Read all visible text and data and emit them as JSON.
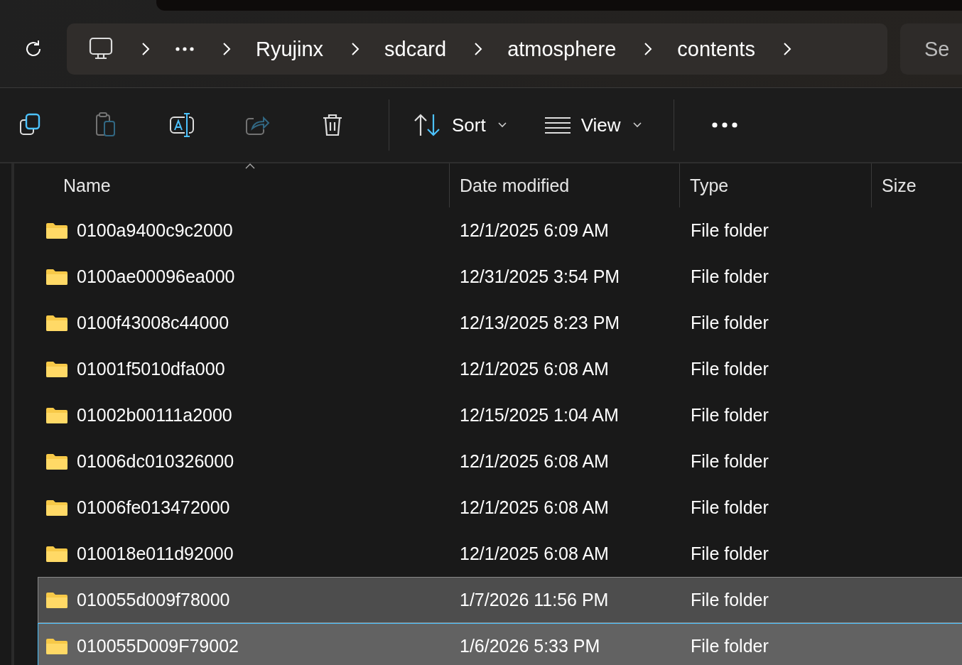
{
  "address_bar": {
    "crumbs": [
      "Ryujinx",
      "sdcard",
      "atmosphere",
      "contents"
    ],
    "search_placeholder": "Se"
  },
  "toolbar": {
    "buttons": [
      {
        "kind": "copy",
        "disabled": false
      },
      {
        "kind": "paste",
        "disabled": true
      },
      {
        "kind": "rename",
        "disabled": false
      },
      {
        "kind": "share",
        "disabled": true
      },
      {
        "kind": "delete",
        "disabled": false
      }
    ],
    "sort_label": "Sort",
    "view_label": "View"
  },
  "table": {
    "columns": [
      "Name",
      "Date modified",
      "Type",
      "Size"
    ],
    "rows": [
      {
        "name": "0100a9400c9c2000",
        "date": "12/1/2025 6:09 AM",
        "type": "File folder",
        "selected": false,
        "focused": false
      },
      {
        "name": "0100ae00096ea000",
        "date": "12/31/2025 3:54 PM",
        "type": "File folder",
        "selected": false,
        "focused": false
      },
      {
        "name": "0100f43008c44000",
        "date": "12/13/2025 8:23 PM",
        "type": "File folder",
        "selected": false,
        "focused": false
      },
      {
        "name": "01001f5010dfa000",
        "date": "12/1/2025 6:08 AM",
        "type": "File folder",
        "selected": false,
        "focused": false
      },
      {
        "name": "01002b00111a2000",
        "date": "12/15/2025 1:04 AM",
        "type": "File folder",
        "selected": false,
        "focused": false
      },
      {
        "name": "01006dc010326000",
        "date": "12/1/2025 6:08 AM",
        "type": "File folder",
        "selected": false,
        "focused": false
      },
      {
        "name": "01006fe013472000",
        "date": "12/1/2025 6:08 AM",
        "type": "File folder",
        "selected": false,
        "focused": false
      },
      {
        "name": "010018e011d92000",
        "date": "12/1/2025 6:08 AM",
        "type": "File folder",
        "selected": false,
        "focused": false
      },
      {
        "name": "010055d009f78000",
        "date": "1/7/2026 11:56 PM",
        "type": "File folder",
        "selected": true,
        "focused": false
      },
      {
        "name": "010055D009F79002",
        "date": "1/6/2026 5:33 PM",
        "type": "File folder",
        "selected": true,
        "focused": true
      }
    ]
  }
}
